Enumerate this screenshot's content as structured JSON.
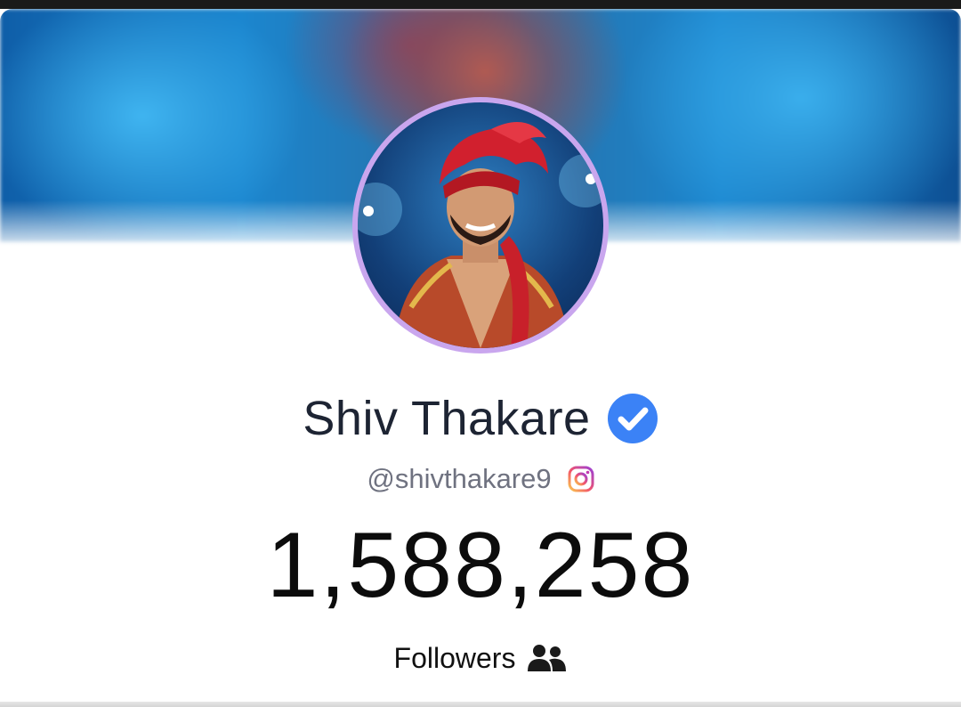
{
  "profile": {
    "name": "Shiv Thakare",
    "handle": "@shivthakare9",
    "follower_count": "1,588,258",
    "followers_label": "Followers",
    "verified": true,
    "platform_icon": "instagram-icon",
    "followers_icon": "users-icon"
  },
  "colors": {
    "avatar_ring": "#c9a6ee",
    "verified_badge": "#3b82f6",
    "name_text": "#1d2433",
    "handle_text": "#6f7280"
  }
}
